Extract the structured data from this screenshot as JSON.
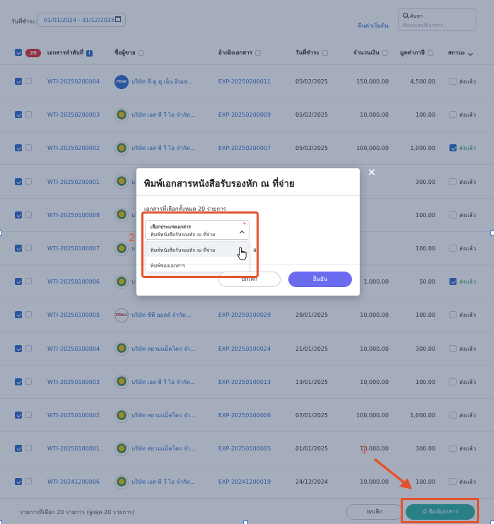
{
  "filter": {
    "date_label": "วันที่ชำระ:",
    "date_range": "01/01/2024 - 31/12/2025",
    "reset_label": "คืนค่าเริ่มต้น",
    "search_label": "ค้นหา",
    "search_placeholder": "ค้นหาเลขที่เอกสาร"
  },
  "table": {
    "selected_count": "20",
    "headers": {
      "doc_no": "เอกสารลำดับที่",
      "seller": "ชื่อผู้ขาย",
      "ref": "อ้างอิงเอกสาร",
      "pay_date": "วันที่ชำระ",
      "amount": "จำนวนเงิน",
      "tax": "มูลค่าภาษี",
      "status": "สถานะ"
    },
    "rows": [
      {
        "doc": "WTI-20250200004",
        "seller": "บริษัท พี ดู ดู เอ็น อินเท...",
        "logo": "feak",
        "ref": "EXP-20250200011",
        "date": "05/02/2025",
        "amount": "150,000.00",
        "tax": "4,500.00",
        "status": "ส่งแล้ว",
        "status_checked": false
      },
      {
        "doc": "WTI-20250200003",
        "seller": "บริษัท เอส พี วี ไอ จำกัด...",
        "logo": "es",
        "ref": "EXP-20250200009",
        "date": "05/02/2025",
        "amount": "10,000.00",
        "tax": "100.00",
        "status": "ส่งแล้ว",
        "status_checked": false
      },
      {
        "doc": "WTI-20250200002",
        "seller": "บริษัท เอส พี วี ไอ จำกัด...",
        "logo": "es",
        "ref": "EXP-20250200007",
        "date": "05/02/2025",
        "amount": "100,000.00",
        "tax": "1,000.00",
        "status": "ส่งแล้ว",
        "status_checked": true
      },
      {
        "doc": "WTI-20250200001",
        "seller": "บ",
        "logo": "es",
        "ref": "",
        "date": "",
        "amount": "",
        "tax": "300.00",
        "status": "ส่งแล้ว",
        "status_checked": false
      },
      {
        "doc": "WTI-20250100008",
        "seller": "บ",
        "logo": "es",
        "ref": "",
        "date": "",
        "amount": "",
        "tax": "100.00",
        "status": "ส่งแล้ว",
        "status_checked": false
      },
      {
        "doc": "WTI-20250100007",
        "seller": "บ",
        "logo": "es",
        "ref": "",
        "date": "",
        "amount": "",
        "tax": "100.00",
        "status": "ส่งแล้ว",
        "status_checked": false
      },
      {
        "doc": "WTI-20250100006",
        "seller": "บ",
        "logo": "es",
        "ref": "",
        "date": "",
        "amount": "1,000.00",
        "tax": "50.00",
        "status": "ส่งแล้ว",
        "status_checked": true
      },
      {
        "doc": "WTI-20250100005",
        "seller": "บริษัท ซีพี ออลล์ จำกัด...",
        "logo": "cp",
        "ref": "EXP-20250100029",
        "date": "28/01/2025",
        "amount": "10,000.00",
        "tax": "100.00",
        "status": "ส่งแล้ว",
        "status_checked": false
      },
      {
        "doc": "WTI-20250100004",
        "seller": "บริษัท สยามแม็คโคร จำ...",
        "logo": "es",
        "ref": "EXP-20250100024",
        "date": "21/01/2025",
        "amount": "10,000.00",
        "tax": "300.00",
        "status": "ส่งแล้ว",
        "status_checked": false
      },
      {
        "doc": "WTI-20250100003",
        "seller": "บริษัท เอส พี วี ไอ จำกัด...",
        "logo": "es",
        "ref": "EXP-20250100013",
        "date": "13/01/2025",
        "amount": "10,000.00",
        "tax": "100.00",
        "status": "ส่งแล้ว",
        "status_checked": false
      },
      {
        "doc": "WTI-20250100002",
        "seller": "บริษัท สยามแม็คโคร จำ...",
        "logo": "es",
        "ref": "EXP-20250100006",
        "date": "07/01/2025",
        "amount": "100,000.00",
        "tax": "1,000.00",
        "status": "ส่งแล้ว",
        "status_checked": false
      },
      {
        "doc": "WTI-20250100001",
        "seller": "บริษัท สยามแม็คโคร จำ...",
        "logo": "es",
        "ref": "EXP-20250100005",
        "date": "01/01/2025",
        "amount": "10,000.00",
        "tax": "300.00",
        "status": "ส่งแล้ว",
        "status_checked": false
      },
      {
        "doc": "WTI-20241200006",
        "seller": "บริษัท เอส พี วี ไอ จำกัด...",
        "logo": "es",
        "ref": "EXP-20241200019",
        "date": "24/12/2024",
        "amount": "10,000.00",
        "tax": "100.00",
        "status": "ส่งแล้ว",
        "status_checked": false
      }
    ]
  },
  "footer": {
    "selection_info": "รายการที่เลือก 20 รายการ (สูงสุด 20 รายการ)",
    "cancel_label": "ยกเลิก",
    "print_label": "พิมพ์เอกสาร"
  },
  "modal": {
    "title": "พิมพ์เอกสารหนังสือรับรองหัก ณ ที่จ่าย",
    "subtitle": "เอกสารที่เลือกทั้งหมด 20 รายการ",
    "dropdown_label": "เลือกประเภทเอกสาร",
    "dropdown_required": "*",
    "dropdown_value": "พิมพ์หนังสือรับรองหัก ณ ที่จ่าย",
    "options": [
      "พิมพ์หนังสือรับรองหัก ณ ที่จ่าย",
      "พิมพ์ซองเอกสาร"
    ],
    "hidden_fragment": "a",
    "cancel_label": "ยกเลิก",
    "confirm_label": "ยืนยัน",
    "close_symbol": "✕"
  },
  "annotations": {
    "step1": "1",
    "step2": "2",
    "color": "#e4522b"
  },
  "logos": {
    "feak": "FEAK",
    "cp": "CPALL"
  }
}
